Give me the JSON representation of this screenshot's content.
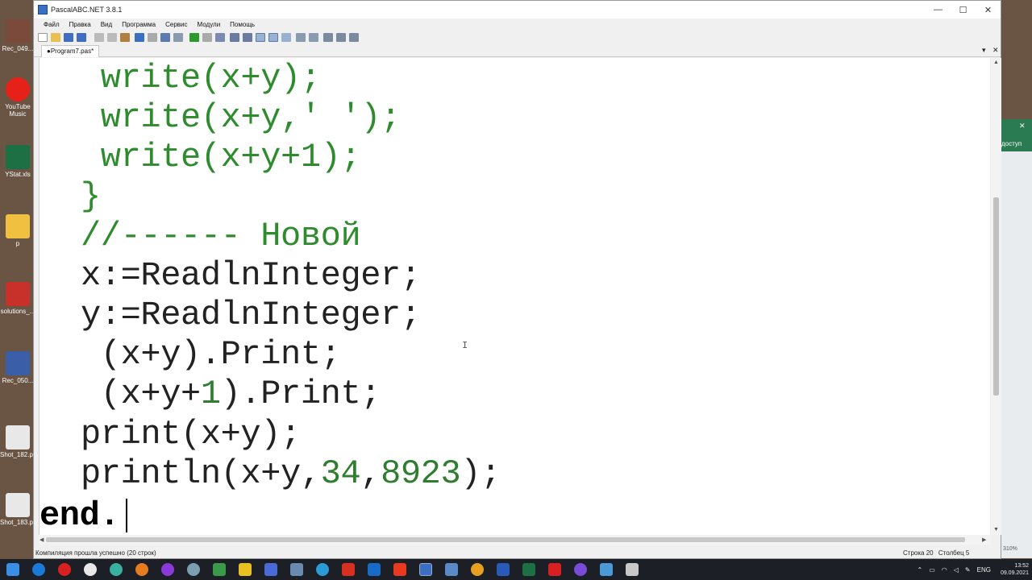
{
  "window": {
    "title": "PascalABC.NET 3.8.1",
    "min_glyph": "—",
    "max_glyph": "☐",
    "close_glyph": "✕"
  },
  "menu": [
    "Файл",
    "Правка",
    "Вид",
    "Программа",
    "Сервис",
    "Модули",
    "Помощь"
  ],
  "tab": {
    "label": "●Program7.pas*",
    "dropdown_glyph": "▾",
    "close_glyph": "✕"
  },
  "code": {
    "l1": {
      "a": " write(x+y);"
    },
    "l2": {
      "a": " write(x+y,' ');"
    },
    "l3": {
      "a": " write(x+y+1);"
    },
    "l4": {
      "a": "}"
    },
    "l5": {
      "a": "//------ Новой"
    },
    "l6": {
      "a": "x:=ReadlnInteger;"
    },
    "l7": {
      "a": "y:=ReadlnInteger;"
    },
    "l8": {
      "a": " (x+y).Print;"
    },
    "l9": {
      "a": " (x+y+",
      "b": "1",
      "c": ").Print;"
    },
    "l10": {
      "a": "print(x+y);"
    },
    "l11": {
      "a": "println(x+y,",
      "b": "34",
      "c": ",",
      "d": "8923",
      "e": ");"
    },
    "l12": {
      "a": "end",
      "b": "."
    }
  },
  "status": {
    "left": "Компиляция прошла успешно (20 строк)",
    "row_label": "Строка",
    "row": "20",
    "col_label": "Столбец",
    "col": "5"
  },
  "desktop": {
    "icons": [
      "Rec_049...",
      "YouTube Music",
      "YStat.xls",
      "p",
      "solutions_...",
      "Rec_050...",
      "Shot_182.p...",
      "Shot_183.p..."
    ],
    "side_panel_text": "доступ",
    "side_panel_close": "✕",
    "zoom": "310%"
  },
  "tray": {
    "lang": "ENG",
    "time": "13:52",
    "date": "09.09.2021"
  },
  "colors": {
    "code_green": "#2e8b2e",
    "code_default": "#222222",
    "number_green": "#2f7d2f",
    "keyword": "#000000"
  }
}
